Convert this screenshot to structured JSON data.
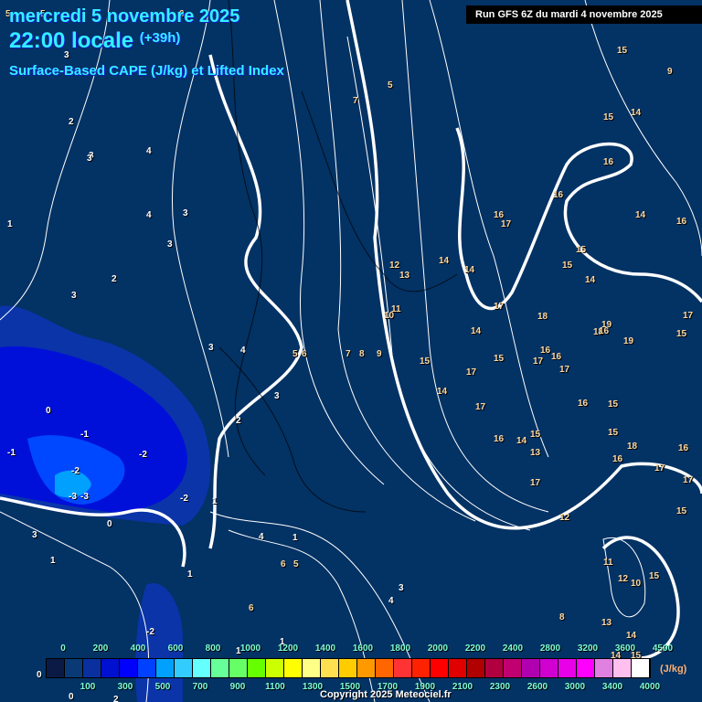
{
  "header": {
    "date": "mercredi 5 novembre 2025",
    "time": "22:00 locale",
    "offset": "(+39h)",
    "product": "Surface-Based CAPE (J/kg) et Lifted Index",
    "run": "Run GFS 6Z du mardi 4 novembre 2025"
  },
  "legend": {
    "top_labels": [
      "0",
      "200",
      "400",
      "600",
      "800",
      "1000",
      "1200",
      "1400",
      "1600",
      "1800",
      "2000",
      "2200",
      "2400",
      "2800",
      "3200",
      "3600",
      "4500"
    ],
    "bottom_labels": [
      "100",
      "300",
      "500",
      "700",
      "900",
      "1100",
      "1300",
      "1500",
      "1700",
      "1900",
      "2100",
      "2300",
      "2600",
      "3000",
      "3400",
      "4000"
    ],
    "unit": "(J/kg)",
    "colors": [
      "#0a1a45",
      "#0a3a75",
      "#0a30a0",
      "#0010d0",
      "#0000ff",
      "#0040ff",
      "#00a0ff",
      "#33ccff",
      "#66ffff",
      "#66ff99",
      "#66ff66",
      "#66ff00",
      "#ccff00",
      "#ffff00",
      "#ffff88",
      "#ffe050",
      "#ffcc00",
      "#ff9900",
      "#ff6600",
      "#ff3333",
      "#ff2200",
      "#ff0000",
      "#e00000",
      "#b00000",
      "#b00040",
      "#c00070",
      "#b000b0",
      "#d000d0",
      "#e800e8",
      "#ff00ff",
      "#e080e0",
      "#ffc0f0",
      "#ffffff"
    ]
  },
  "lifted_index_labels": [
    "5",
    "5",
    "6",
    "3",
    "2",
    "3",
    "4",
    "4",
    "3",
    "3",
    "2",
    "3",
    "1",
    "3",
    "3",
    "4",
    "3",
    "4",
    "5",
    "6",
    "7",
    "8",
    "9",
    "7",
    "5",
    "2",
    "1",
    "0",
    "-1",
    "-1",
    "-2",
    "-2",
    "-3",
    "-3",
    "-2",
    "0",
    "3",
    "1",
    "6",
    "1",
    "5",
    "6",
    "1",
    "3",
    "4",
    "1",
    "1",
    "0",
    "-2",
    "2",
    "0",
    "12",
    "13",
    "10",
    "11",
    "14",
    "14",
    "16",
    "17",
    "15",
    "14",
    "17",
    "14",
    "15",
    "17",
    "17",
    "16",
    "14",
    "13",
    "15",
    "18",
    "17",
    "16",
    "12",
    "17",
    "17",
    "16",
    "16",
    "15",
    "15",
    "16",
    "17",
    "17",
    "15",
    "16",
    "18",
    "19",
    "18",
    "19",
    "16",
    "17",
    "14",
    "15",
    "15",
    "16",
    "16",
    "15",
    "14",
    "16",
    "14",
    "15",
    "9",
    "11",
    "12",
    "15",
    "10",
    "8",
    "13",
    "14",
    "15",
    "14",
    "15"
  ],
  "copyright": "Copyright 2025 Meteociel.fr"
}
